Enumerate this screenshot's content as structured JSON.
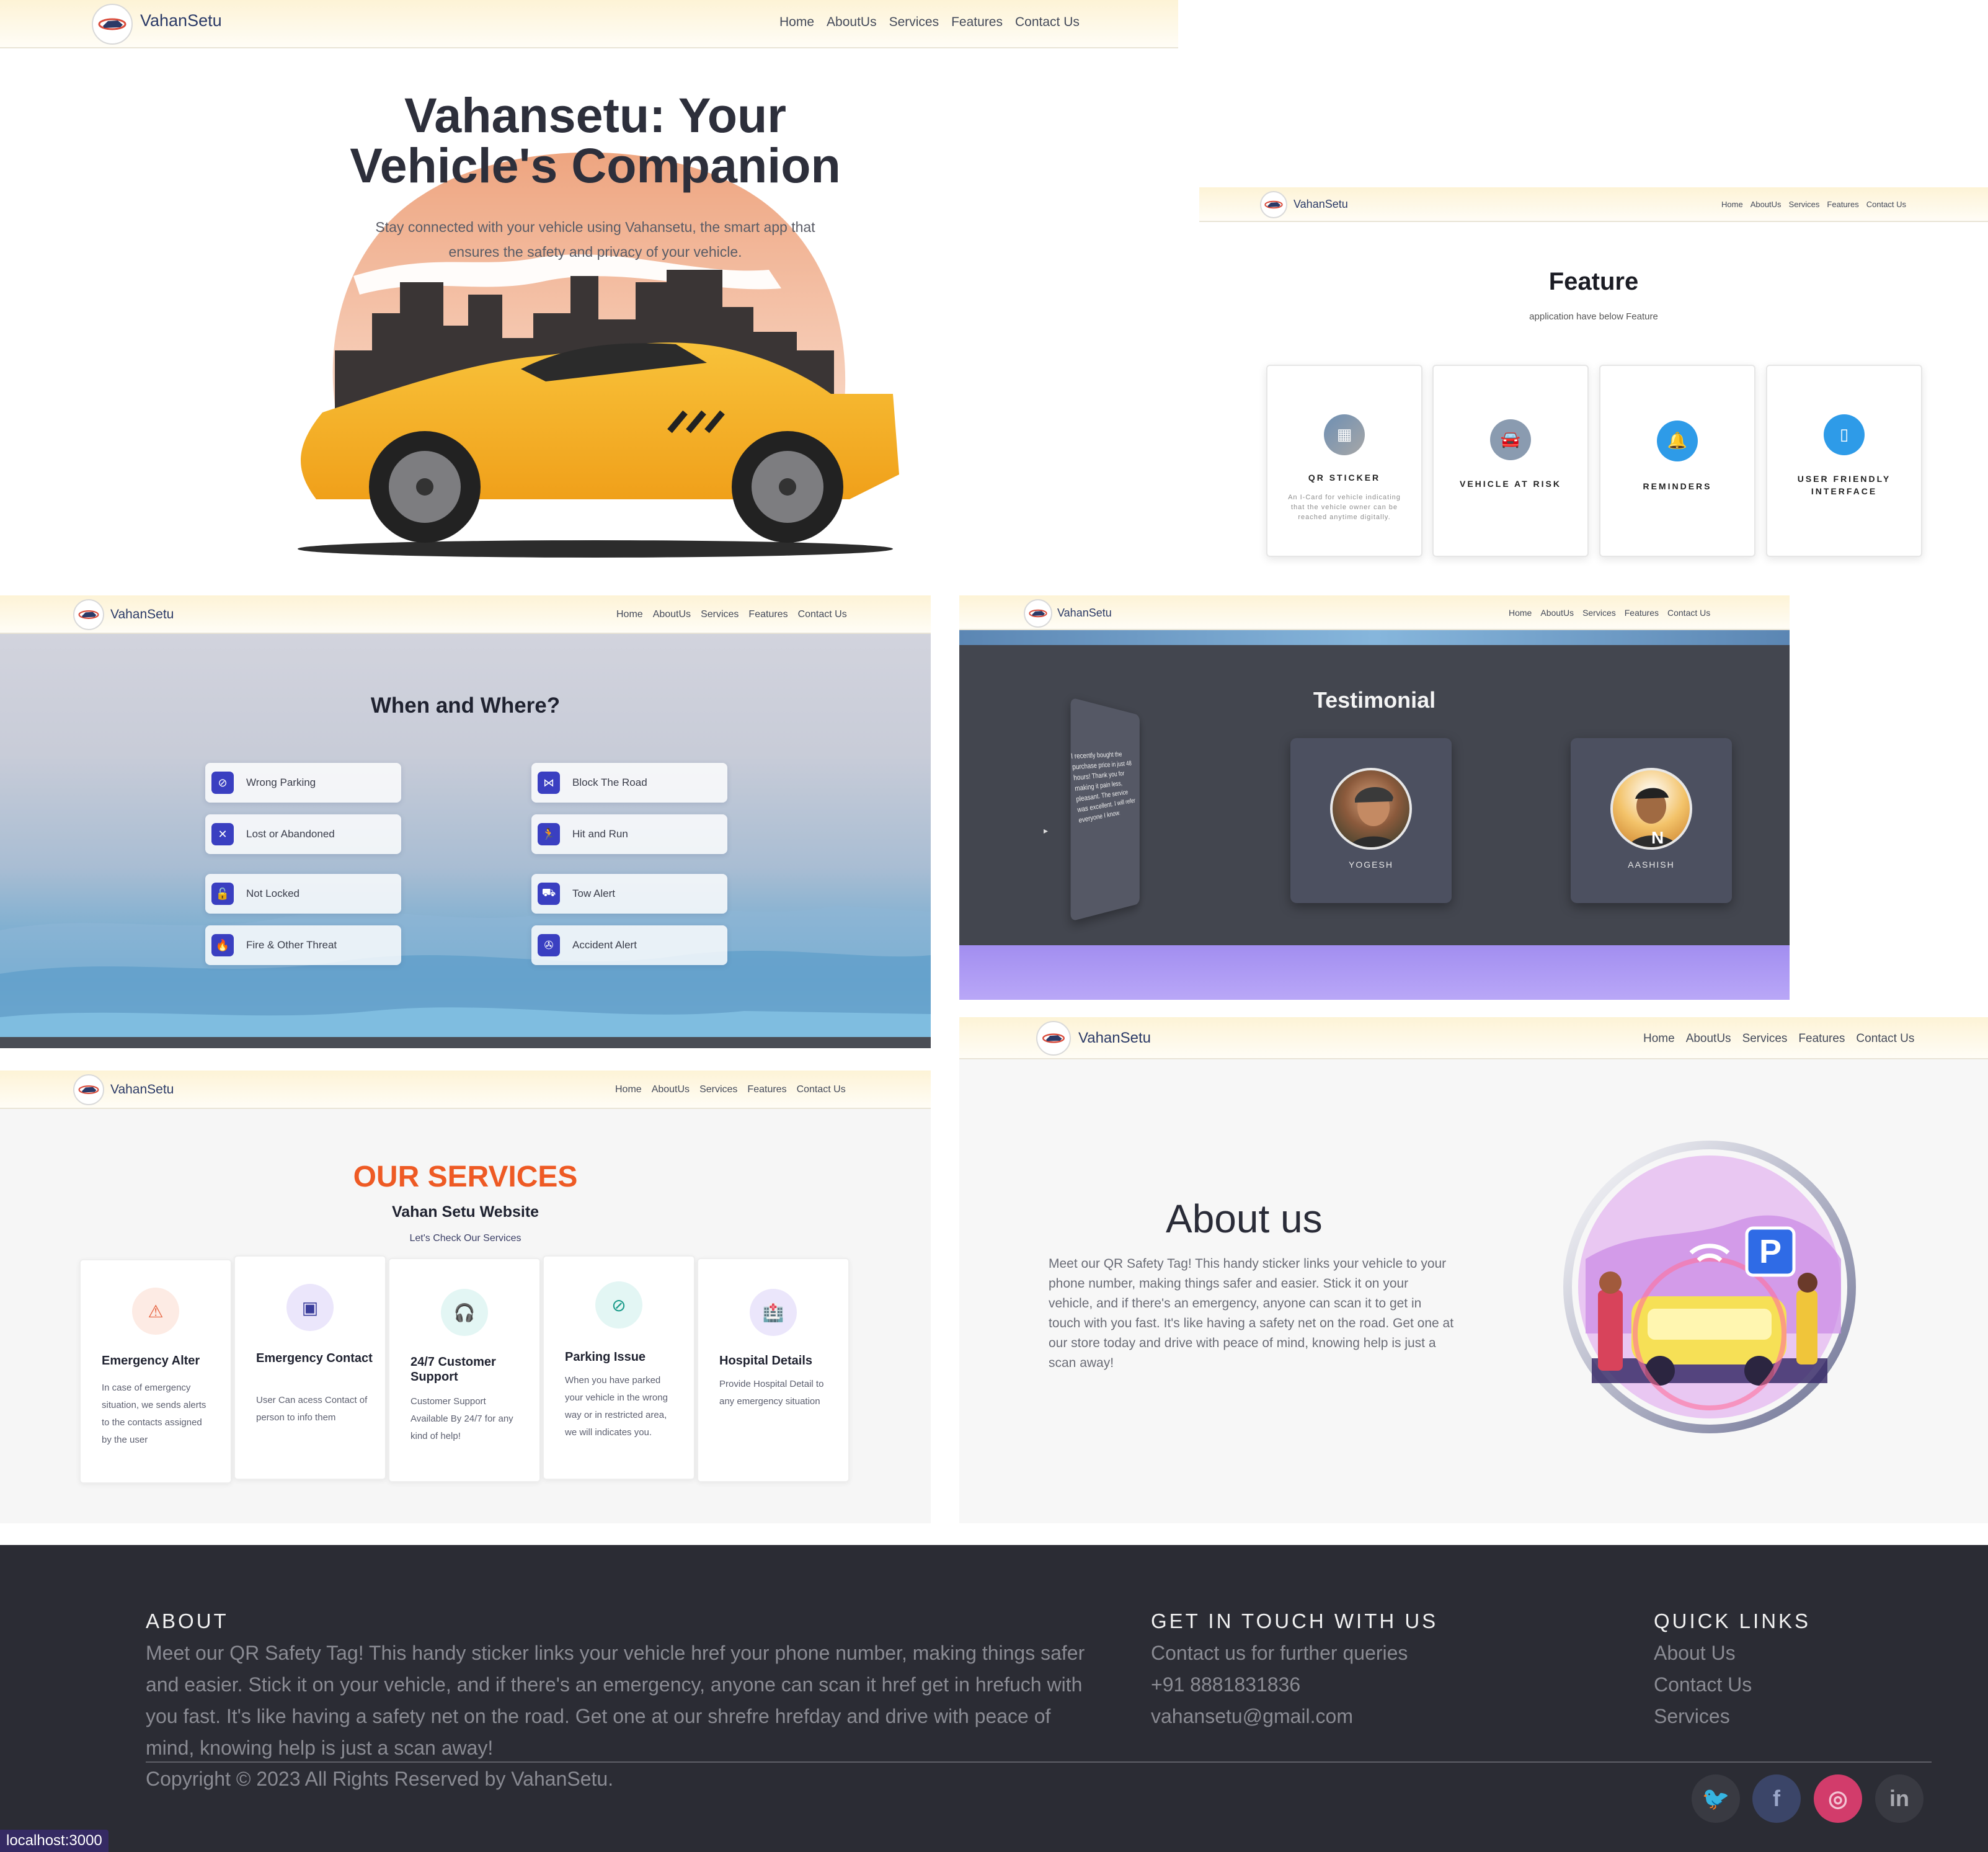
{
  "nav": {
    "brand": "VahanSetu",
    "links": [
      "Home",
      "AboutUs",
      "Services",
      "Features",
      "Contact Us"
    ]
  },
  "hero": {
    "title_line1": "Vahansetu: Your",
    "title_line2": "Vehicle's Companion",
    "subtitle_line1": "Stay connected with your vehicle using Vahansetu, the smart app that",
    "subtitle_line2": "ensures the safety and privacy of your vehicle."
  },
  "features": {
    "title": "Feature",
    "subtitle": "application have below Feature",
    "cards": [
      {
        "title": "QR STICKER",
        "desc": "An I-Card for vehicle indicating that the vehicle owner can be reached anytime digitally.",
        "icon": "qr-icon"
      },
      {
        "title": "VEHICLE AT RISK",
        "desc": "",
        "icon": "car-icon"
      },
      {
        "title": "REMINDERS",
        "desc": "",
        "icon": "bell-icon"
      },
      {
        "title": "USER FRIENDLY INTERFACE",
        "desc": "",
        "icon": "phone-icon"
      }
    ]
  },
  "when_where": {
    "title": "When and Where?",
    "items": [
      {
        "label": "Wrong Parking",
        "icon": "no-parking-icon"
      },
      {
        "label": "Block The Road",
        "icon": "barrier-icon"
      },
      {
        "label": "Lost or Abandoned",
        "icon": "lost-icon"
      },
      {
        "label": "Hit and Run",
        "icon": "run-icon"
      },
      {
        "label": "Not Locked",
        "icon": "lock-icon"
      },
      {
        "label": "Tow Alert",
        "icon": "tow-icon"
      },
      {
        "label": "Fire & Other Threat",
        "icon": "fire-icon"
      },
      {
        "label": "Accident Alert",
        "icon": "accident-icon"
      }
    ]
  },
  "testimonial": {
    "title": "Testimonial",
    "quote": "I recently bought the purchase price in just 48 hours! Thank you for making it pain less, pleasant. The service was excellent. I will refer everyone I know.",
    "people": [
      {
        "name": "YOGESH"
      },
      {
        "name": "AASHISH"
      }
    ]
  },
  "services": {
    "title": "OUR SERVICES",
    "subtitle": "Vahan Setu Website",
    "tagline": "Let's Check Our Services",
    "cards": [
      {
        "title": "Emergency Alter",
        "desc": "In case of emergency situation, we sends alerts to the contacts assigned by the user",
        "icon": "alert-icon"
      },
      {
        "title": "Emergency Contact",
        "desc": "User Can acess Contact of person to info them",
        "icon": "contact-card-icon"
      },
      {
        "title": "24/7 Customer Support",
        "desc": "Customer Support Available By 24/7 for any kind of help!",
        "icon": "headset-icon"
      },
      {
        "title": "Parking Issue",
        "desc": "When you have parked your vehicle in the wrong way or in restricted area, we will indicates you.",
        "icon": "parking-icon"
      },
      {
        "title": "Hospital Details",
        "desc": "Provide Hospital Detail to any emergency situation",
        "icon": "hospital-icon"
      }
    ]
  },
  "about": {
    "title": "About us",
    "text": "Meet our QR Safety Tag! This handy sticker links your vehicle to your phone number, making things safer and easier. Stick it on your vehicle, and if there's an emergency, anyone can scan it to get in touch with you fast. It's like having a safety net on the road. Get one at our store today and drive with peace of mind, knowing help is just a scan away!",
    "illustration_letter": "P"
  },
  "footer": {
    "about_heading": "ABOUT",
    "about_text": "Meet our QR Safety Tag! This handy sticker links your vehicle href your phone number, making things safer and easier. Stick it on your vehicle, and if there's an emergency, anyone can scan it href get in hrefuch with you fast. It's like having a safety net on the road. Get one at our shrefre hrefday and drive with peace of mind, knowing help is just a scan away!",
    "contact_heading": "GET IN TOUCH WITH US",
    "contact_line": "Contact us for further queries",
    "phone": "+91 8881831836",
    "email": "vahansetu@gmail.com",
    "links_heading": "QUICK LINKS",
    "links": [
      "About Us",
      "Contact Us",
      "Services"
    ],
    "copyright": "Copyright © 2023 All Rights Reserved by VahanSetu.",
    "social": [
      {
        "name": "twitter",
        "glyph": "🐦"
      },
      {
        "name": "facebook",
        "glyph": "f"
      },
      {
        "name": "instagram",
        "glyph": "◎"
      },
      {
        "name": "linkedin",
        "glyph": "in"
      }
    ]
  },
  "status_bar": {
    "url": "localhost:3000"
  },
  "colors": {
    "services_title": "#ee5a24",
    "icon_purple": "#3a3fc1",
    "footer_bg": "#2b2c34"
  }
}
